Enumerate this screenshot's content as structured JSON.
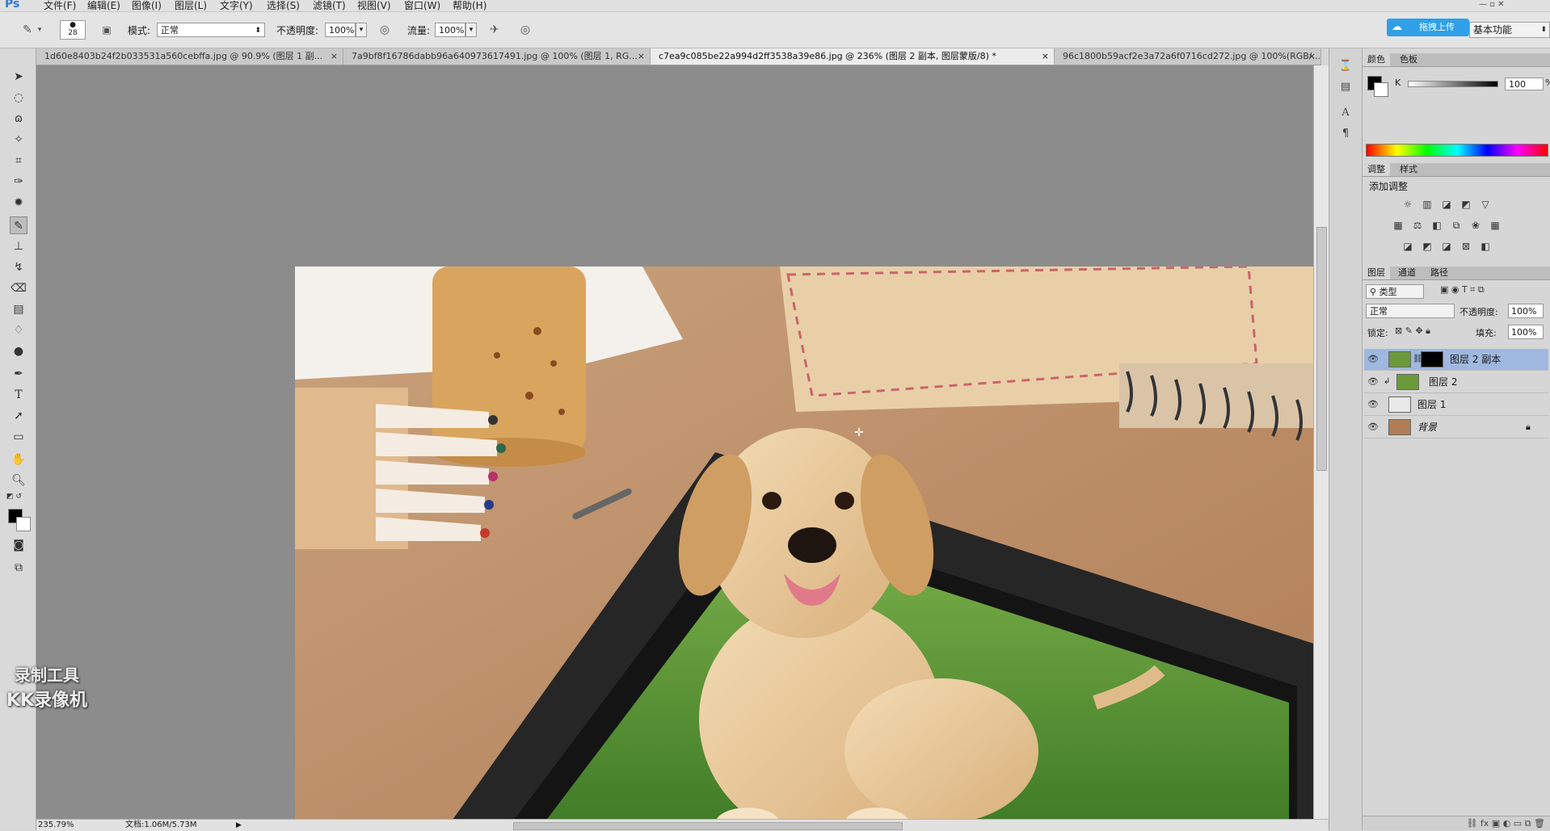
{
  "app": {
    "logo": "Ps"
  },
  "menu": [
    "文件(F)",
    "编辑(E)",
    "图像(I)",
    "图层(L)",
    "文字(Y)",
    "选择(S)",
    "滤镜(T)",
    "视图(V)",
    "窗口(W)",
    "帮助(H)"
  ],
  "options": {
    "brush_size": "28",
    "mode_label": "模式:",
    "mode_value": "正常",
    "opacity_label": "不透明度:",
    "opacity_value": "100%",
    "flow_label": "流量:",
    "flow_value": "100%",
    "upload_button": "拖拽上传",
    "workspace": "基本功能"
  },
  "tabs": [
    {
      "label": "1d60e8403b24f2b033531a560cebffa.jpg @ 90.9% (图层 1 副...",
      "close": "×"
    },
    {
      "label": "7a9bf8f16786dabb96a640973617491.jpg @ 100% (图层 1, RG...",
      "close": "×"
    },
    {
      "label": "c7ea9c085be22a994d2ff3538a39e86.jpg @ 236% (图层 2 副本, 图层蒙版/8) *",
      "close": "×"
    },
    {
      "label": "96c1800b59acf2e3a72a6f0716cd272.jpg @ 100%(RGB/...",
      "close": "×"
    }
  ],
  "status": {
    "zoom": "235.79%",
    "doc": "文档:1.06M/5.73M"
  },
  "color_panel": {
    "tab1": "颜色",
    "tab2": "色板",
    "channel": "K",
    "value": "100",
    "unit": "%"
  },
  "adjust_panel": {
    "tab1": "调整",
    "tab2": "样式",
    "title": "添加调整"
  },
  "layers_panel": {
    "tab1": "图层",
    "tab2": "通道",
    "tab3": "路径",
    "filter": "类型",
    "blend_mode": "正常",
    "opacity_label": "不透明度:",
    "opacity_value": "100%",
    "lock_label": "锁定:",
    "fill_label": "填充:",
    "fill_value": "100%",
    "layers": [
      {
        "name": "图层 2 副本",
        "selected": true
      },
      {
        "name": "图层 2",
        "selected": false
      },
      {
        "name": "图层 1",
        "selected": false
      },
      {
        "name": "背景",
        "selected": false
      }
    ]
  },
  "watermark": {
    "line1": "录制工具",
    "line2": "KK录像机"
  },
  "colors": {
    "accent": "#2f7bd8",
    "canvas_bg": "#8c8c8c",
    "layer_selected": "#9fb8e0"
  }
}
